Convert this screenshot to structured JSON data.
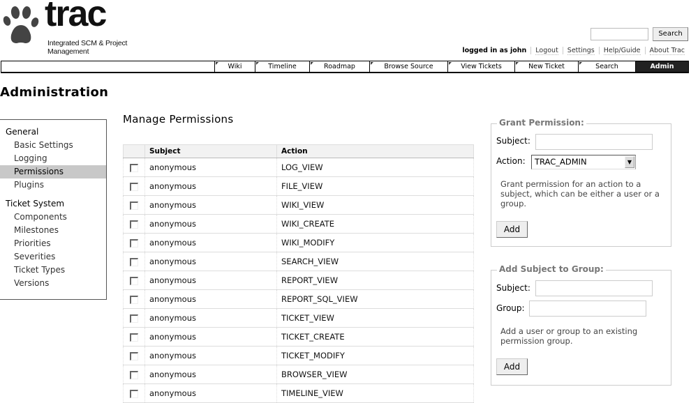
{
  "header": {
    "logo_text": "trac",
    "tagline": "Integrated SCM & Project Management",
    "search": {
      "value": "",
      "placeholder": "",
      "button_label": "Search"
    },
    "metanav": {
      "logged_in": "logged in as john",
      "links": [
        "Logout",
        "Settings",
        "Help/Guide",
        "About Trac"
      ]
    }
  },
  "mainnav": {
    "tabs": [
      {
        "label": "Wiki",
        "active": false
      },
      {
        "label": "Timeline",
        "active": false
      },
      {
        "label": "Roadmap",
        "active": false
      },
      {
        "label": "Browse Source",
        "active": false
      },
      {
        "label": "View Tickets",
        "active": false
      },
      {
        "label": "New Ticket",
        "active": false
      },
      {
        "label": "Search",
        "active": false
      },
      {
        "label": "Admin",
        "active": true
      }
    ]
  },
  "page_title": "Administration",
  "sidebar": {
    "groups": [
      {
        "title": "General",
        "items": [
          "Basic Settings",
          "Logging",
          "Permissions",
          "Plugins"
        ]
      },
      {
        "title": "Ticket System",
        "items": [
          "Components",
          "Milestones",
          "Priorities",
          "Severities",
          "Ticket Types",
          "Versions"
        ]
      }
    ],
    "active_item": "Permissions"
  },
  "content": {
    "title": "Manage Permissions",
    "table": {
      "columns": [
        "",
        "Subject",
        "Action"
      ],
      "rows": [
        {
          "subject": "anonymous",
          "action": "LOG_VIEW",
          "checked": false
        },
        {
          "subject": "anonymous",
          "action": "FILE_VIEW",
          "checked": false
        },
        {
          "subject": "anonymous",
          "action": "WIKI_VIEW",
          "checked": false
        },
        {
          "subject": "anonymous",
          "action": "WIKI_CREATE",
          "checked": false
        },
        {
          "subject": "anonymous",
          "action": "WIKI_MODIFY",
          "checked": false
        },
        {
          "subject": "anonymous",
          "action": "SEARCH_VIEW",
          "checked": false
        },
        {
          "subject": "anonymous",
          "action": "REPORT_VIEW",
          "checked": false
        },
        {
          "subject": "anonymous",
          "action": "REPORT_SQL_VIEW",
          "checked": false
        },
        {
          "subject": "anonymous",
          "action": "TICKET_VIEW",
          "checked": false
        },
        {
          "subject": "anonymous",
          "action": "TICKET_CREATE",
          "checked": false
        },
        {
          "subject": "anonymous",
          "action": "TICKET_MODIFY",
          "checked": false
        },
        {
          "subject": "anonymous",
          "action": "BROWSER_VIEW",
          "checked": false
        },
        {
          "subject": "anonymous",
          "action": "TIMELINE_VIEW",
          "checked": false
        }
      ]
    }
  },
  "grant": {
    "legend": "Grant Permission:",
    "subject_label": "Subject:",
    "subject_value": "",
    "action_label": "Action:",
    "action_selected": "TRAC_ADMIN",
    "hint": "Grant permission for an action to a subject, which can be either a user or a group.",
    "button_label": "Add"
  },
  "group": {
    "legend": "Add Subject to Group:",
    "subject_label": "Subject:",
    "subject_value": "",
    "group_label": "Group:",
    "group_value": "",
    "hint": "Add a user or group to an existing permission group.",
    "button_label": "Add"
  }
}
